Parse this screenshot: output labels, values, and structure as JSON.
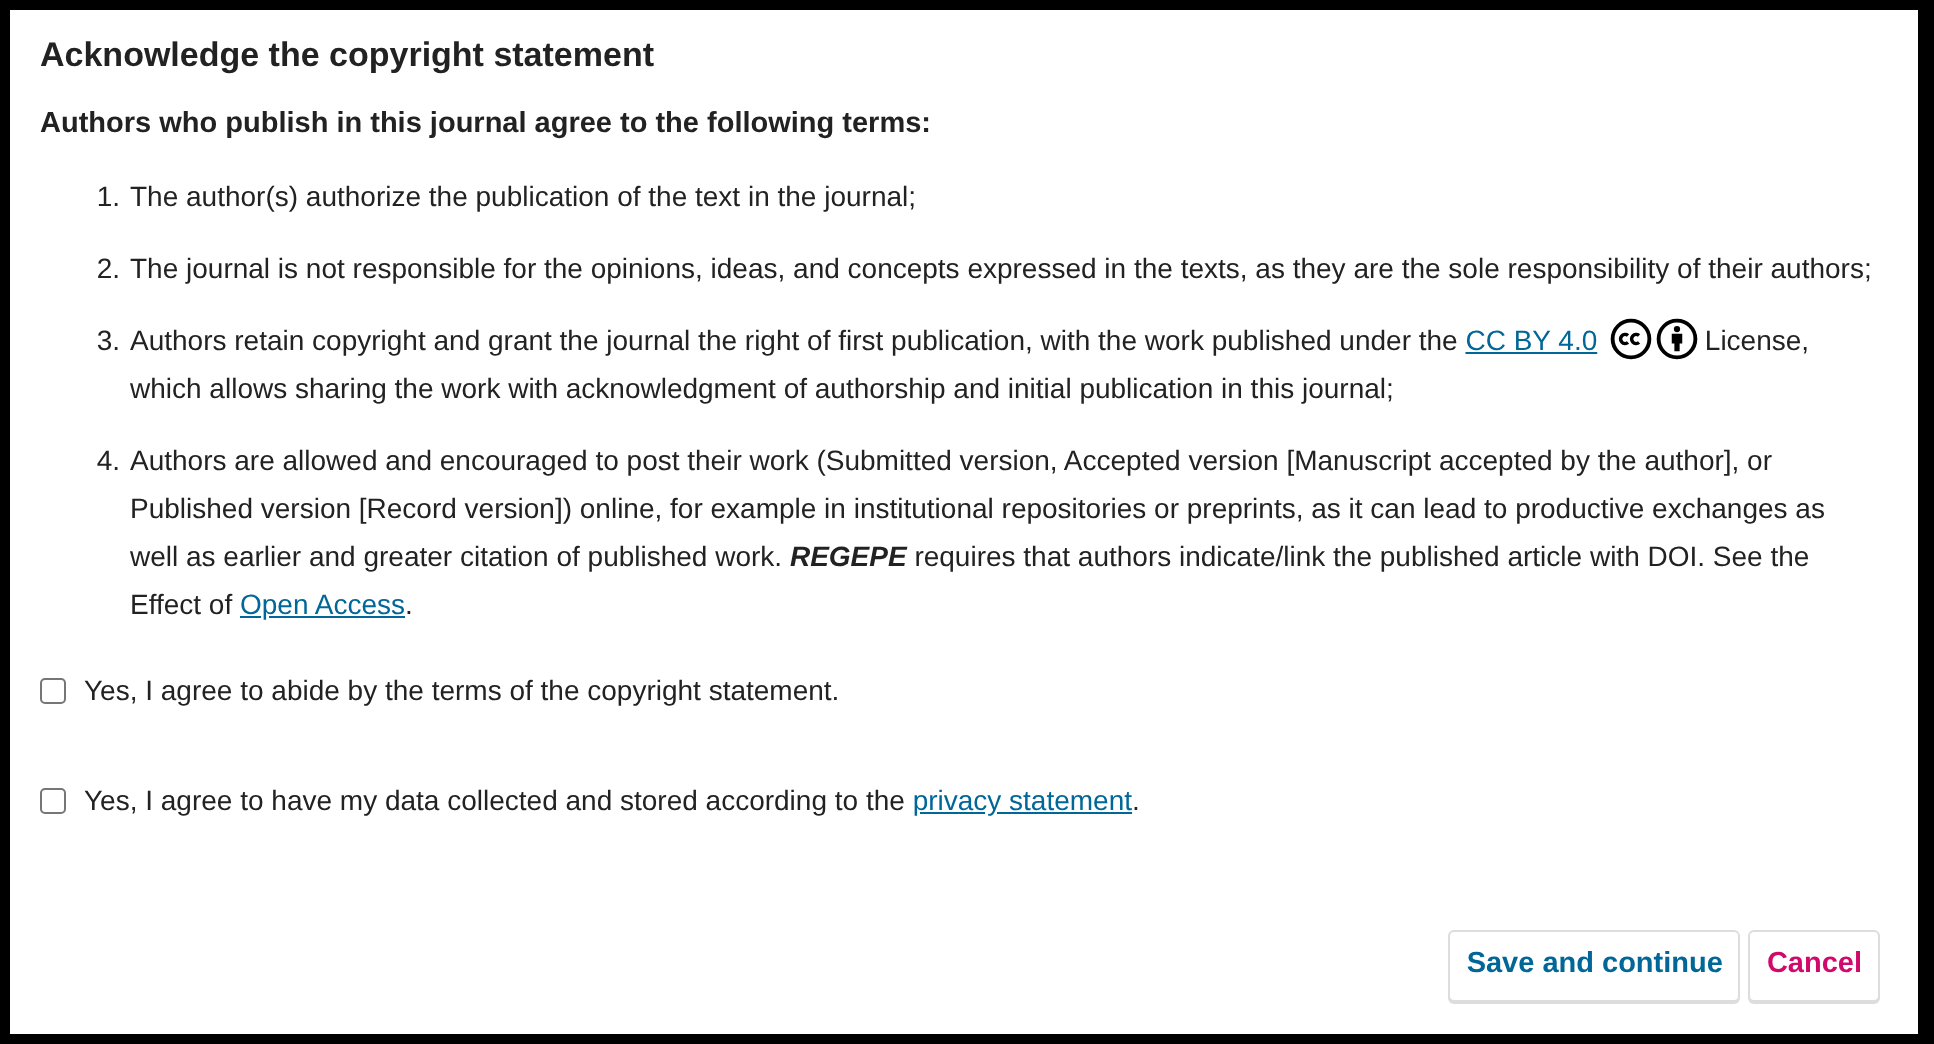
{
  "section": {
    "title": "Acknowledge the copyright statement"
  },
  "terms_intro": "Authors who publish in this journal agree to the following terms:",
  "terms": [
    {
      "number": "1.",
      "parts": [
        {
          "kind": "text",
          "text": "The author(s) authorize the publication of the text in the journal;"
        }
      ]
    },
    {
      "number": "2.",
      "parts": [
        {
          "kind": "text",
          "text": "The journal is not responsible for the opinions, ideas, and concepts expressed in the texts, as they are the sole responsibility of their authors;"
        }
      ]
    },
    {
      "number": "3.",
      "parts": [
        {
          "kind": "text",
          "text": "Authors retain copyright and grant the journal the right of first publication, with the work published under the "
        },
        {
          "kind": "link",
          "text": "CC BY 4.0"
        },
        {
          "kind": "license-icons"
        },
        {
          "kind": "text",
          "text": " License, which allows sharing the work with acknowledgment of authorship and initial publication in this journal;"
        }
      ]
    },
    {
      "number": "4.",
      "parts": [
        {
          "kind": "text",
          "text": "Authors are allowed and encouraged to post their work (Submitted version, Accepted version [Manuscript accepted by the author], or Published version [Record version]) online, for example in institutional repositories or preprints, as it can lead to productive exchanges as well as earlier and greater citation of published work. "
        },
        {
          "kind": "emphasis",
          "text": "REGEPE"
        },
        {
          "kind": "text",
          "text": " requires that authors indicate/link the published article with DOI. See the Effect of "
        },
        {
          "kind": "link",
          "text": "Open Access"
        },
        {
          "kind": "text",
          "text": "."
        }
      ]
    }
  ],
  "agreements": [
    {
      "checked": false,
      "parts": [
        {
          "kind": "text",
          "text": "Yes, I agree to abide by the terms of the copyright statement."
        }
      ]
    },
    {
      "checked": false,
      "parts": [
        {
          "kind": "text",
          "text": "Yes, I agree to have my data collected and stored according to the "
        },
        {
          "kind": "link",
          "text": "privacy statement"
        },
        {
          "kind": "text",
          "text": "."
        }
      ]
    }
  ],
  "buttons": [
    {
      "kind": "primary",
      "label": "Save and continue"
    },
    {
      "kind": "cancel",
      "label": "Cancel"
    }
  ]
}
